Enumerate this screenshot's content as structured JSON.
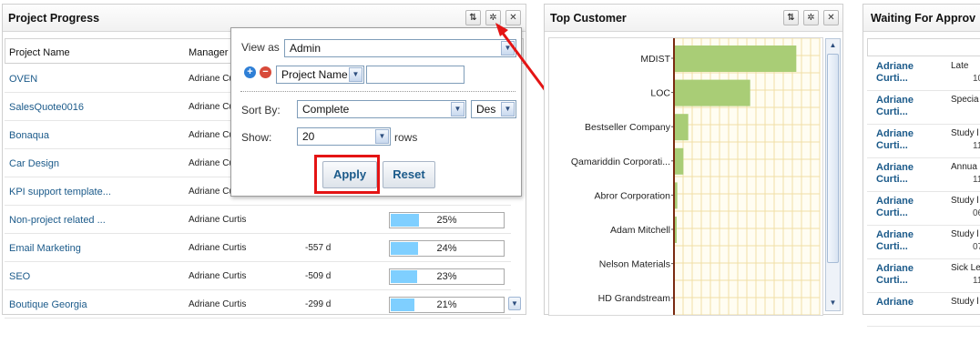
{
  "project_progress": {
    "title": "Project Progress",
    "columns": {
      "name": "Project Name",
      "manager": "Manager"
    },
    "rows": [
      {
        "name": "OVEN",
        "manager": "Adriane Cu",
        "days": "",
        "percent": ""
      },
      {
        "name": "SalesQuote0016",
        "manager": "Adriane Cu",
        "days": "",
        "percent": ""
      },
      {
        "name": "Bonaqua",
        "manager": "Adriane Cu",
        "days": "",
        "percent": ""
      },
      {
        "name": "Car Design",
        "manager": "Adriane Cu",
        "days": "",
        "percent": ""
      },
      {
        "name": "KPI support template...",
        "manager": "Adriane Cu",
        "days": "",
        "percent": ""
      },
      {
        "name": "Non-project related ...",
        "manager": "Adriane Curtis",
        "days": "",
        "percent": "25%",
        "fill": 0.25
      },
      {
        "name": "Email Marketing",
        "manager": "Adriane Curtis",
        "days": "-557 d",
        "percent": "24%",
        "fill": 0.24
      },
      {
        "name": "SEO",
        "manager": "Adriane Curtis",
        "days": "-509 d",
        "percent": "23%",
        "fill": 0.23
      },
      {
        "name": "Boutique Georgia",
        "manager": "Adriane Curtis",
        "days": "-299 d",
        "percent": "21%",
        "fill": 0.21
      }
    ]
  },
  "settings_popup": {
    "view_as_label": "View as",
    "view_as_value": "Admin",
    "filter_field_value": "Project Name",
    "sort_by_label": "Sort By:",
    "sort_by_value": "Complete",
    "sort_order_value": "Des",
    "show_label": "Show:",
    "show_value": "20",
    "rows_label": "rows",
    "apply_label": "Apply",
    "reset_label": "Reset"
  },
  "top_customer": {
    "title": "Top Customer",
    "chart_data": {
      "type": "bar",
      "orientation": "horizontal",
      "categories": [
        "MDIST",
        "LOC",
        "Bestseller Company",
        "Qamariddin Corporati...",
        "Abror Corporation",
        "Adam Mitchell",
        "Nelson Materials",
        "HD Grandstream"
      ],
      "values": [
        100,
        62,
        11,
        7,
        2,
        1.5,
        0,
        0
      ],
      "xlim": [
        0,
        120
      ],
      "grid": true,
      "bar_color": "#a9cd76"
    }
  },
  "waiting": {
    "title": "Waiting For Approv",
    "rows": [
      {
        "name_line1": "Adriane",
        "name_line2": "Curti...",
        "type": "Late",
        "date": "10"
      },
      {
        "name_line1": "Adriane",
        "name_line2": "Curti...",
        "type": "Specia",
        "date": ""
      },
      {
        "name_line1": "Adriane",
        "name_line2": "Curti...",
        "type": "Study l",
        "date": "11"
      },
      {
        "name_line1": "Adriane",
        "name_line2": "Curti...",
        "type": "Annua",
        "date": "11"
      },
      {
        "name_line1": "Adriane",
        "name_line2": "Curti...",
        "type": "Study l",
        "date": "06"
      },
      {
        "name_line1": "Adriane",
        "name_line2": "Curti...",
        "type": "Study l",
        "date": "07"
      },
      {
        "name_line1": "Adriane",
        "name_line2": "Curti...",
        "type": "Sick Le",
        "date": "11"
      },
      {
        "name_line1": "Adriane",
        "name_line2": "",
        "type": "Study l",
        "date": ""
      }
    ]
  },
  "colors": {
    "link": "#1b5a8a",
    "progress_fill": "#7fcfff",
    "highlight": "#e41414",
    "axis": "#7a2a10"
  },
  "icons": {
    "refresh": "refresh-icon",
    "settings": "gear-icon",
    "close": "close-icon"
  }
}
